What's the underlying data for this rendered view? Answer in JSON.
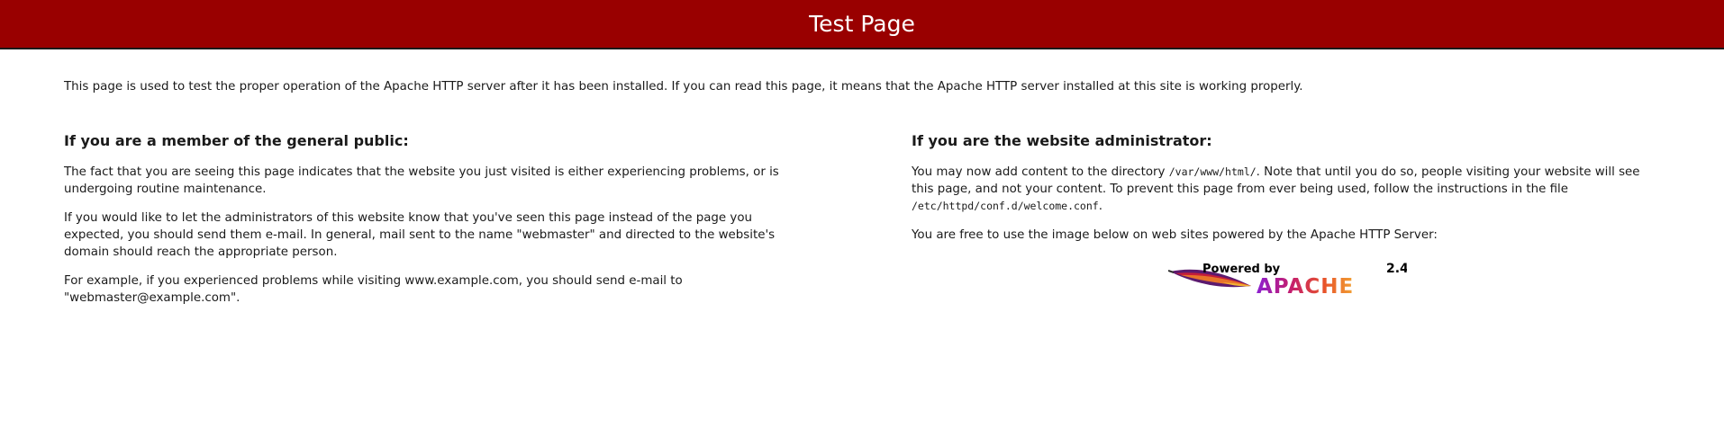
{
  "header": {
    "title": "Test Page",
    "background": "#990000"
  },
  "intro": {
    "text": "This page is used to test the proper operation of the Apache HTTP server after it has been installed. If you can read this page, it means that the Apache HTTP server installed at this site is working properly."
  },
  "public_section": {
    "heading": "If you are a member of the general public:",
    "p1": "The fact that you are seeing this page indicates that the website you just visited is either experiencing problems, or is undergoing routine maintenance.",
    "p2": "If you would like to let the administrators of this website know that you've seen this page instead of the page you expected, you should send them e-mail. In general, mail sent to the name \"webmaster\" and directed to the website's domain should reach the appropriate person.",
    "p3": "For example, if you experienced problems while visiting www.example.com, you should send e-mail to \"webmaster@example.com\"."
  },
  "admin_section": {
    "heading": "If you are the website administrator:",
    "p1_before": "You may now add content to the directory ",
    "p1_dir": "/var/www/html/",
    "p1_after": ". Note that until you do so, people visiting your website will see this page, and not your content. To prevent this page from ever being used, follow the instructions in the file ",
    "p1_file": "/etc/httpd/conf.d/welcome.conf",
    "p1_end": ".",
    "p2": "You are free to use the image below on web sites powered by the Apache HTTP Server:"
  },
  "powered_badge": {
    "powered_by": "Powered by",
    "brand": "APACHE",
    "version": "2.4",
    "icon": "apache-feather-icon"
  }
}
